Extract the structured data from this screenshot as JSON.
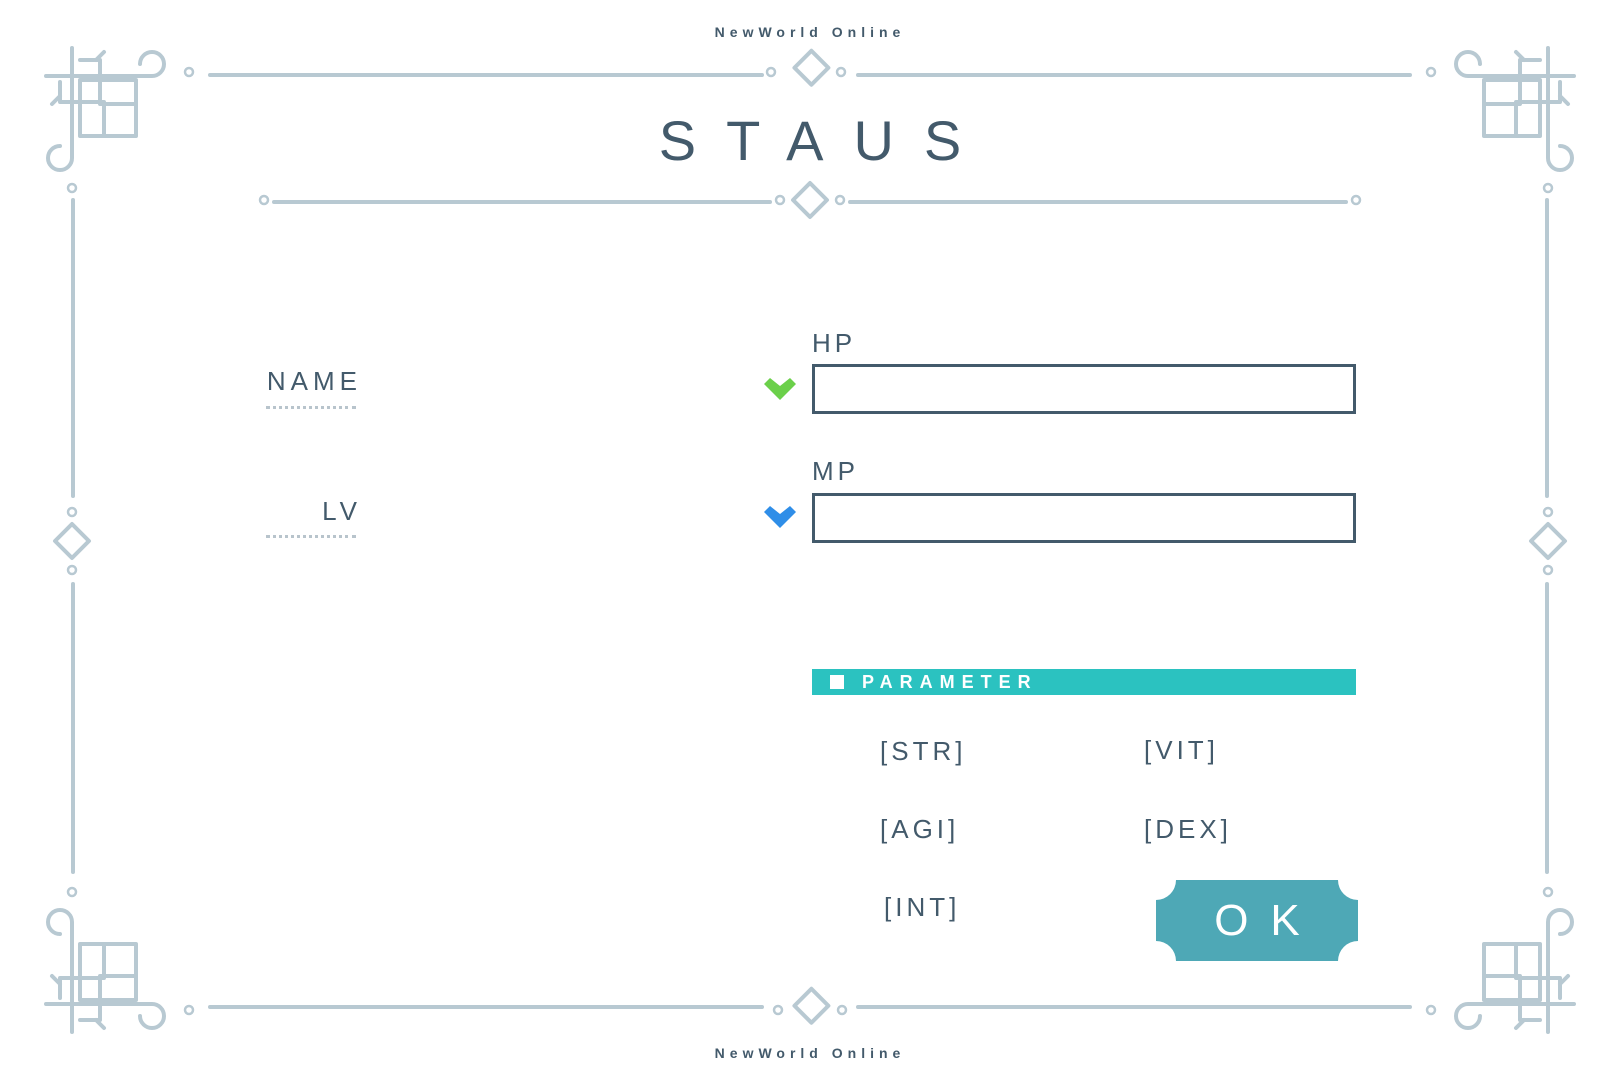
{
  "brand": {
    "top": "NewWorld Online",
    "bottom": "NewWorld Online"
  },
  "title": "STAUS",
  "fields": {
    "name_label": "NAME",
    "lv_label": "LV"
  },
  "bars": {
    "hp": {
      "label": "HP",
      "value": "",
      "heart_color": "#6bd04a"
    },
    "mp": {
      "label": "MP",
      "value": "",
      "heart_color": "#2f8ee8"
    }
  },
  "parameter": {
    "header": "PARAMETER",
    "header_color": "#2bc2c0",
    "stats": [
      "[STR]",
      "[VIT]",
      "[AGI]",
      "[DEX]",
      "[INT]"
    ]
  },
  "ok_button": {
    "label": "OK",
    "color": "#4ea8b6"
  },
  "colors": {
    "text": "#435a6b",
    "frame": "#b8c9d2"
  }
}
